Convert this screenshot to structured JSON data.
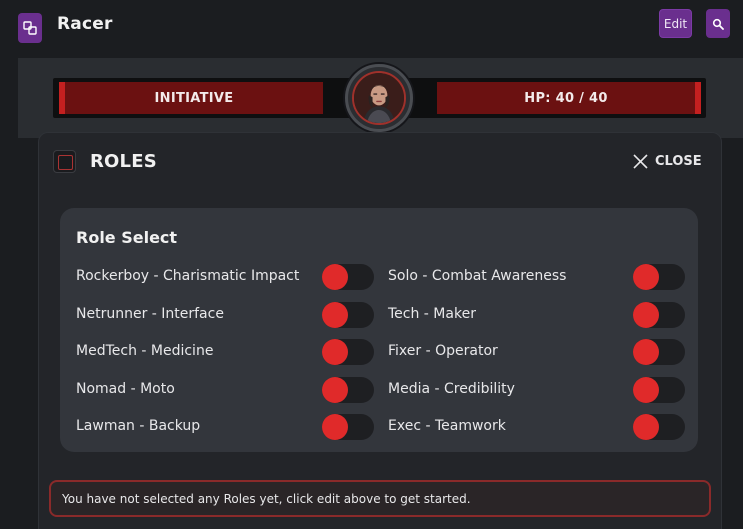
{
  "header": {
    "title": "Racer",
    "edit_label": "Edit"
  },
  "combat": {
    "initiative_label": "INITIATIVE",
    "hp_label": "HP: 40 / 40"
  },
  "roles_panel": {
    "title": "ROLES",
    "close_label": "CLOSE",
    "section_title": "Role Select",
    "roles_left": [
      {
        "label": "Rockerboy - Charismatic Impact",
        "selected": false
      },
      {
        "label": "Netrunner - Interface",
        "selected": false
      },
      {
        "label": "MedTech - Medicine",
        "selected": false
      },
      {
        "label": "Nomad - Moto",
        "selected": false
      },
      {
        "label": "Lawman - Backup",
        "selected": false
      }
    ],
    "roles_right": [
      {
        "label": "Solo - Combat Awareness",
        "selected": false
      },
      {
        "label": "Tech - Maker",
        "selected": false
      },
      {
        "label": "Fixer - Operator",
        "selected": false
      },
      {
        "label": "Media - Credibility",
        "selected": false
      },
      {
        "label": "Exec - Teamwork",
        "selected": false
      }
    ],
    "notice": "You have not selected any Roles yet, click edit above to get started."
  },
  "icons": {
    "app": "character-sheet-icon",
    "search": "search-icon",
    "roles": "roles-icon",
    "close": "close-icon"
  },
  "colors": {
    "accent": "#6a2f8e",
    "danger": "#e02a2a",
    "bar": "#6b1111"
  }
}
